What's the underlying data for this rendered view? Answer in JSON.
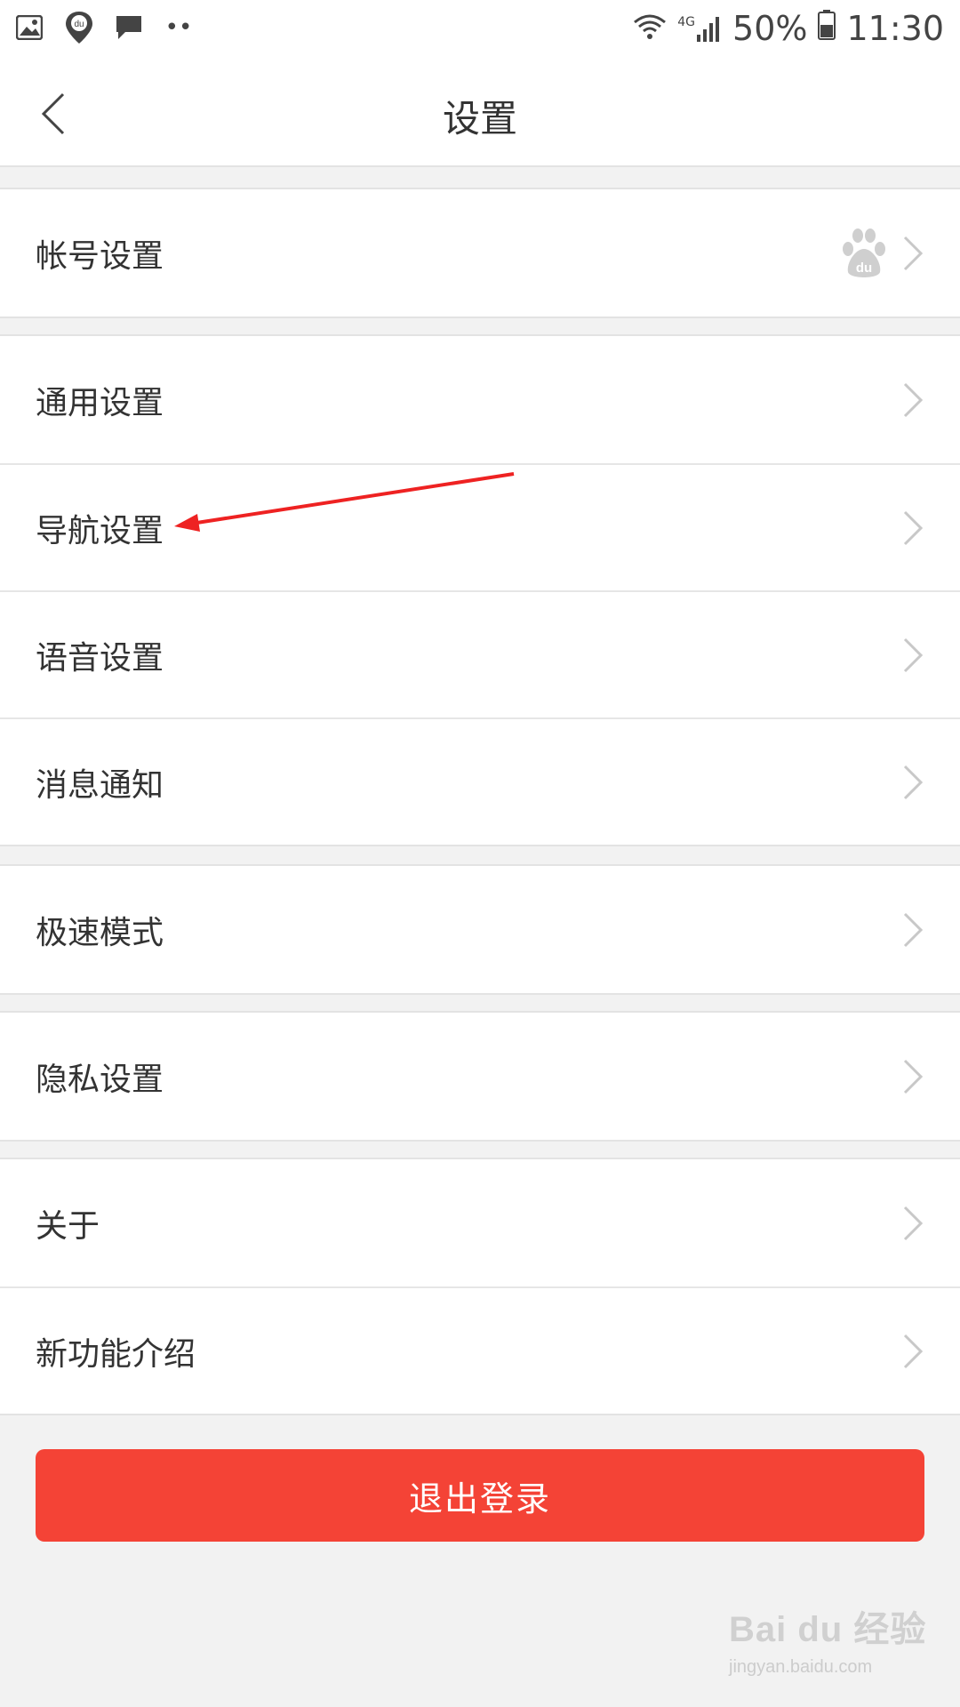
{
  "status_bar": {
    "battery": "50%",
    "time": "11:30",
    "network": "4G",
    "dots": "••"
  },
  "nav": {
    "title": "设置",
    "back_icon": "chevron-left-icon"
  },
  "groups": [
    {
      "items": [
        {
          "label": "帐号设置",
          "extra_icon": "baidu-paw-icon"
        }
      ]
    },
    {
      "items": [
        {
          "label": "通用设置"
        },
        {
          "label": "导航设置"
        },
        {
          "label": "语音设置"
        },
        {
          "label": "消息通知"
        }
      ]
    },
    {
      "items": [
        {
          "label": "极速模式"
        }
      ]
    },
    {
      "items": [
        {
          "label": "隐私设置"
        }
      ]
    },
    {
      "items": [
        {
          "label": "关于"
        },
        {
          "label": "新功能介绍"
        }
      ]
    }
  ],
  "logout_label": "退出登录",
  "watermark": {
    "logo": "Bai du 经验",
    "url": "jingyan.baidu.com"
  },
  "colors": {
    "accent": "#f44336",
    "annotation_arrow": "#ee2222",
    "background": "#f2f2f2"
  }
}
